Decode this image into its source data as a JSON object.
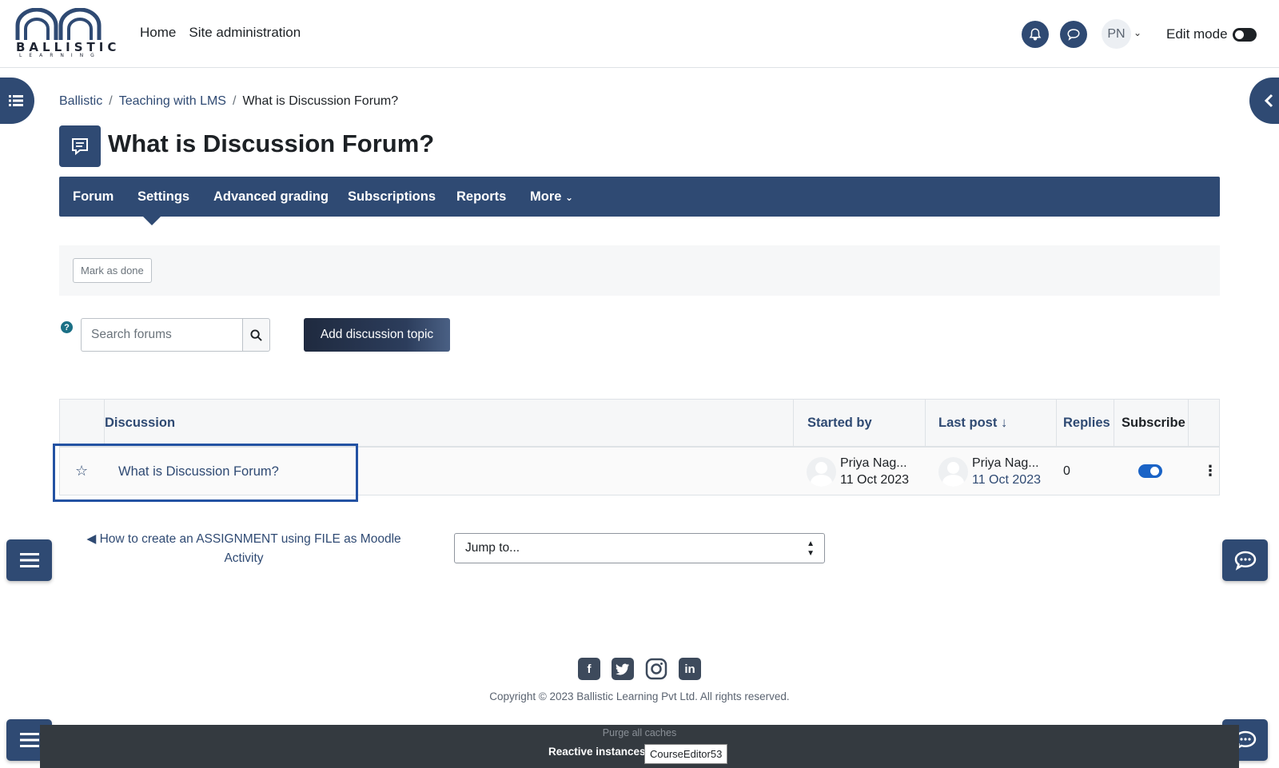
{
  "logo": {
    "word": "BALLISTIC",
    "sub": "LEARNING"
  },
  "primary_nav": [
    "Home",
    "Site administration"
  ],
  "user": {
    "initials": "PN"
  },
  "edit_mode_label": "Edit mode",
  "breadcrumb": [
    "Ballistic",
    "Teaching with LMS",
    "What is Discussion Forum?"
  ],
  "page_title": "What is Discussion Forum?",
  "secondary_nav": [
    "Forum",
    "Settings",
    "Advanced grading",
    "Subscriptions",
    "Reports",
    "More"
  ],
  "mark_done_label": "Mark as done",
  "search": {
    "placeholder": "Search forums"
  },
  "add_topic_label": "Add discussion topic",
  "table": {
    "headers": {
      "discussion": "Discussion",
      "started_by": "Started by",
      "last_post": "Last post",
      "replies": "Replies",
      "subscribe": "Subscribe"
    },
    "rows": [
      {
        "title": "What is Discussion Forum?",
        "started_by": {
          "name": "Priya Nag...",
          "date": "11 Oct 2023"
        },
        "last_post": {
          "name": "Priya Nag...",
          "date": "11 Oct 2023"
        },
        "replies": "0",
        "subscribed": true
      }
    ]
  },
  "prev_activity": "◀ How to create an ASSIGNMENT using FILE as Moodle Activity",
  "jump_to": "Jump to...",
  "social": [
    "facebook-icon",
    "twitter-icon",
    "instagram-icon",
    "linkedin-icon"
  ],
  "copyright": "Copyright © 2023 Ballistic Learning Pvt Ltd. All rights reserved.",
  "purge_caches": "Purge all caches",
  "reactive_label": "Reactive instances:",
  "reactive_button": "CourseEditor53",
  "colors": {
    "primary": "#2f4a73",
    "link": "#2f4a73",
    "toggle_on": "#1a63c6",
    "footer": "#343a40"
  }
}
